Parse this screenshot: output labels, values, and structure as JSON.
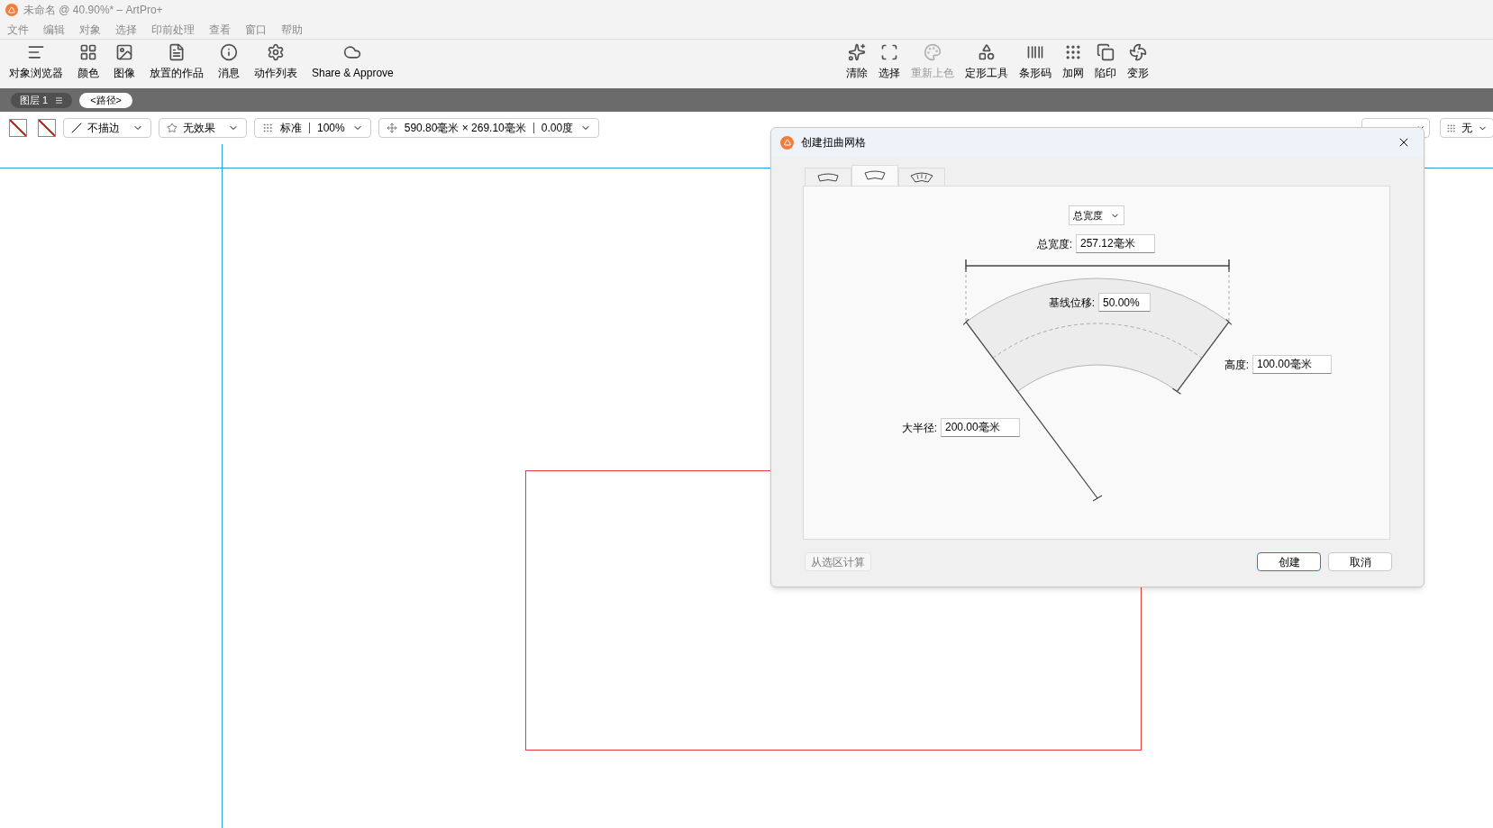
{
  "title_bar": {
    "title": "未命名 @ 40.90%* – ArtPro+"
  },
  "menu": [
    "文件",
    "编辑",
    "对象",
    "选择",
    "印前处理",
    "查看",
    "窗口",
    "帮助"
  ],
  "toolbar_left": [
    {
      "kind": "lines",
      "label": "对象浏览器"
    },
    {
      "kind": "grid",
      "label": "颜色"
    },
    {
      "kind": "image",
      "label": "图像"
    },
    {
      "kind": "document",
      "label": "放置的作品"
    },
    {
      "kind": "info",
      "label": "消息"
    },
    {
      "kind": "gears",
      "label": "动作列表"
    },
    {
      "kind": "cloud",
      "label": "Share & Approve"
    }
  ],
  "toolbar_right": [
    {
      "kind": "sparkle",
      "label": "清除",
      "disabled": false
    },
    {
      "kind": "frame",
      "label": "选择",
      "disabled": false
    },
    {
      "kind": "palette",
      "label": "重新上色",
      "disabled": true
    },
    {
      "kind": "shapes",
      "label": "定形工具",
      "disabled": false
    },
    {
      "kind": "barcode",
      "label": "条形码",
      "disabled": false
    },
    {
      "kind": "dots",
      "label": "加网",
      "disabled": false
    },
    {
      "kind": "squares",
      "label": "陷印",
      "disabled": false
    },
    {
      "kind": "fan",
      "label": "变形",
      "disabled": false
    }
  ],
  "layer_bar": {
    "layer": "图层 1",
    "path": "<路径>"
  },
  "property_bar": {
    "stroke": "不描边",
    "effect": "无效果",
    "blend": "标准",
    "opacity": "100%",
    "size": "590.80毫米 × 269.10毫米",
    "angle": "0.00度",
    "right_dropdown": "无"
  },
  "dialog": {
    "title": "创建扭曲网格",
    "tabs": [
      {
        "kind": "bulge",
        "selected": false
      },
      {
        "kind": "arch",
        "selected": true
      },
      {
        "kind": "fan",
        "selected": false
      }
    ],
    "mode_dropdown": "总宽度",
    "fields": [
      {
        "label": "总宽度:",
        "value": "257.12毫米"
      },
      {
        "label": "基线位移:",
        "value": "50.00%"
      },
      {
        "label": "高度:",
        "value": "100.00毫米"
      },
      {
        "label": "大半径:",
        "value": "200.00毫米"
      }
    ],
    "calc_button": "从选区计算",
    "create_button": "创建",
    "cancel_button": "取消"
  }
}
